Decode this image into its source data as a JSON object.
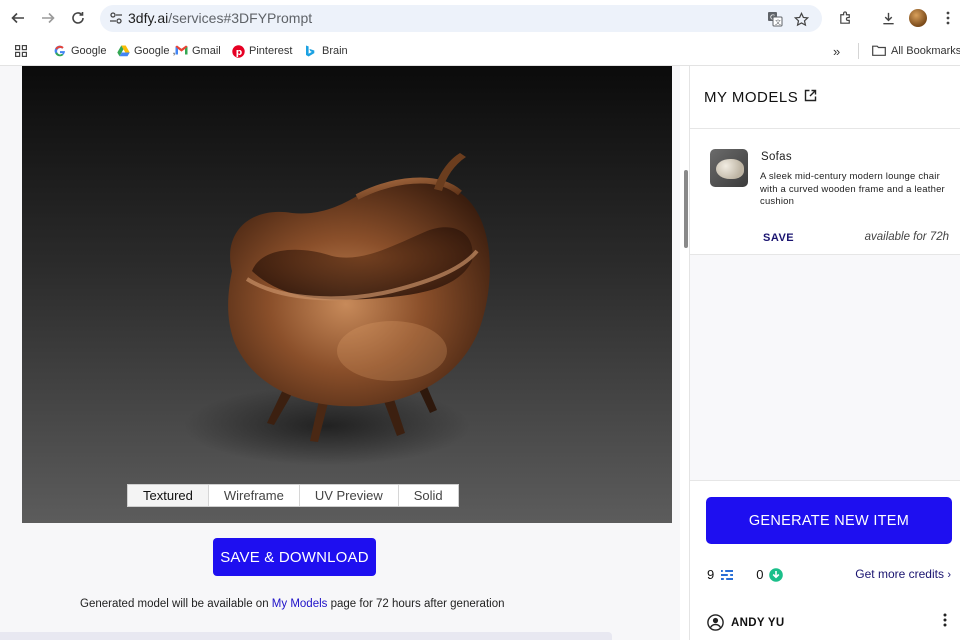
{
  "browser": {
    "url_host": "3dfy.ai",
    "url_path": "/services#3DFYPrompt",
    "icons": {
      "back": "arrow-left",
      "forward": "arrow-right",
      "reload": "reload",
      "site_info": "tune",
      "translate": "translate",
      "bookmark": "star",
      "extensions": "puzzle",
      "downloads": "download",
      "menu": "kebab"
    }
  },
  "bookmarks": {
    "items": [
      {
        "label": "Google",
        "icon": "google-icon"
      },
      {
        "label": "Google ,",
        "icon": "drive-icon"
      },
      {
        "label": "Gmail",
        "icon": "gmail-icon"
      },
      {
        "label": "Pinterest",
        "icon": "pinterest-icon"
      },
      {
        "label": "Brain",
        "icon": "bing-icon"
      }
    ],
    "all_label": "All Bookmarks"
  },
  "viewer": {
    "tabs": [
      "Textured",
      "Wireframe",
      "UV Preview",
      "Solid"
    ],
    "active_tab": "Textured"
  },
  "main": {
    "save_download_label": "SAVE & DOWNLOAD",
    "note_prefix": "Generated model will be available on ",
    "note_link": "My Models",
    "note_suffix": " page for 72 hours after generation"
  },
  "sidebar": {
    "title": "MY MODELS",
    "models": [
      {
        "name": "Sofas",
        "description": "A sleek mid-century modern lounge chair with a curved wooden frame and a leather cushion",
        "save_label": "SAVE",
        "availability": "available for 72h"
      }
    ],
    "generate_label": "GENERATE NEW ITEM",
    "credits_a": "9",
    "credits_b": "0",
    "more_credits_label": "Get more credits",
    "user_name": "ANDY YU"
  },
  "colors": {
    "primary": "#1e0ff0",
    "link": "#1a1470",
    "credit_teal": "#1bbf8a",
    "credit_blue": "#2a6fd6"
  }
}
